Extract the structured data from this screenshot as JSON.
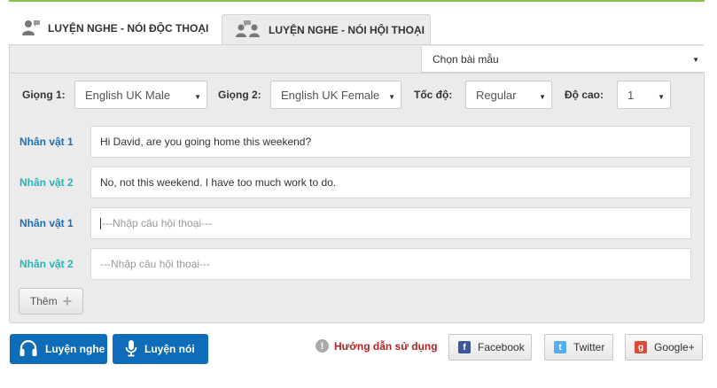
{
  "tabs": [
    {
      "label": "LUYỆN NGHE - NÓI ĐỘC THOẠI",
      "icon": "single-person-speaking-icon",
      "active": true
    },
    {
      "label": "LUYỆN NGHE - NÓI HỘI THOẠI",
      "icon": "two-people-talking-icon",
      "active": false
    }
  ],
  "sample_select": {
    "value": "Chọn bài mẫu"
  },
  "voice_settings": {
    "voice1_label": "Giọng 1:",
    "voice1_value": "English UK Male",
    "voice2_label": "Giọng 2:",
    "voice2_value": "English UK Female",
    "speed_label": "Tốc độ:",
    "speed_value": "Regular",
    "pitch_label": "Độ cao:",
    "pitch_value": "1"
  },
  "dialogue": [
    {
      "speaker": "Nhân vật 1",
      "text": "Hi David, are you going home this weekend?",
      "placeholder": ""
    },
    {
      "speaker": "Nhân vật 2",
      "text": "No, not this weekend. I have too much work to do.",
      "placeholder": ""
    },
    {
      "speaker": "Nhân vật 1",
      "text": "",
      "placeholder": "---Nhập câu hội thoại---"
    },
    {
      "speaker": "Nhân vật 2",
      "text": "",
      "placeholder": "---Nhập câu hội thoại---"
    }
  ],
  "add_button": {
    "label": "Thêm"
  },
  "actions": {
    "listen_label": "Luyện nghe",
    "speak_label": "Luyện nói",
    "help_label": "Hướng dẫn sử dụng"
  },
  "social": {
    "facebook": "Facebook",
    "twitter": "Twitter",
    "google": "Google+"
  },
  "colors": {
    "accent_green": "#8cc152",
    "speaker1": "#1f6fb2",
    "speaker2": "#2bb3b8",
    "primary_button": "#0f6cb8",
    "help_text": "#b22222"
  }
}
